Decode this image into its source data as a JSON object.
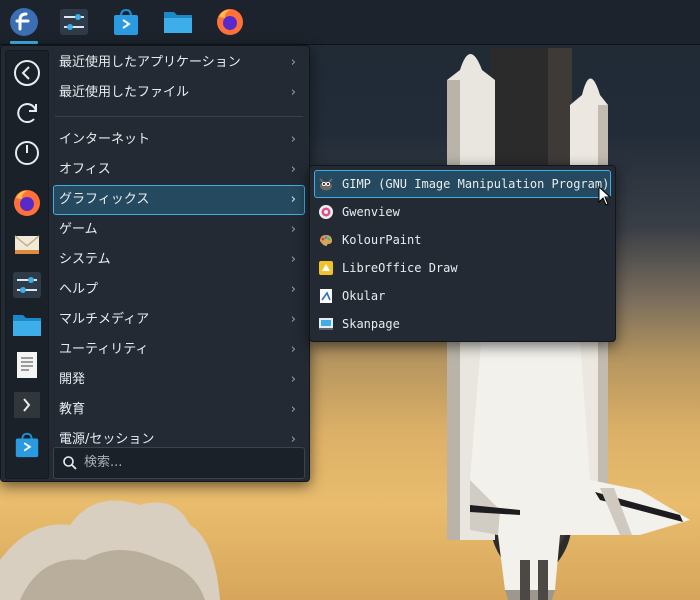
{
  "panel": {
    "items": [
      {
        "name": "fedora-launcher-icon",
        "active": true
      },
      {
        "name": "system-settings-icon"
      },
      {
        "name": "discover-store-icon"
      },
      {
        "name": "dolphin-folder-icon"
      },
      {
        "name": "firefox-icon"
      }
    ]
  },
  "favorites": [
    "back-arrow-icon",
    "refresh-icon",
    "power-icon",
    "firefox-icon",
    "mail-stack-icon",
    "settings-sliders-icon",
    "folder-icon",
    "document-icon",
    "terminal-icon",
    "discover-store-icon"
  ],
  "categories": [
    {
      "label": "最近使用したアプリケーション"
    },
    {
      "label": "最近使用したファイル"
    },
    {
      "label": "インターネット"
    },
    {
      "label": "オフィス"
    },
    {
      "label": "グラフィックス",
      "active": true
    },
    {
      "label": "ゲーム"
    },
    {
      "label": "システム"
    },
    {
      "label": "ヘルプ"
    },
    {
      "label": "マルチメディア"
    },
    {
      "label": "ユーティリティ"
    },
    {
      "label": "開発"
    },
    {
      "label": "教育"
    },
    {
      "label": "電源/セッション"
    }
  ],
  "search": {
    "placeholder": "検索..."
  },
  "submenu": {
    "items": [
      {
        "label": "GIMP (GNU Image Manipulation Program)",
        "icon": "gimp-icon",
        "active": true
      },
      {
        "label": "Gwenview",
        "icon": "gwenview-icon"
      },
      {
        "label": "KolourPaint",
        "icon": "kolourpaint-icon"
      },
      {
        "label": "LibreOffice Draw",
        "icon": "libreoffice-draw-icon"
      },
      {
        "label": "Okular",
        "icon": "okular-icon"
      },
      {
        "label": "Skanpage",
        "icon": "skanpage-icon"
      }
    ]
  },
  "colors": {
    "accent": "#3daee9",
    "panel": "#1c232c",
    "menu": "#232a33"
  }
}
